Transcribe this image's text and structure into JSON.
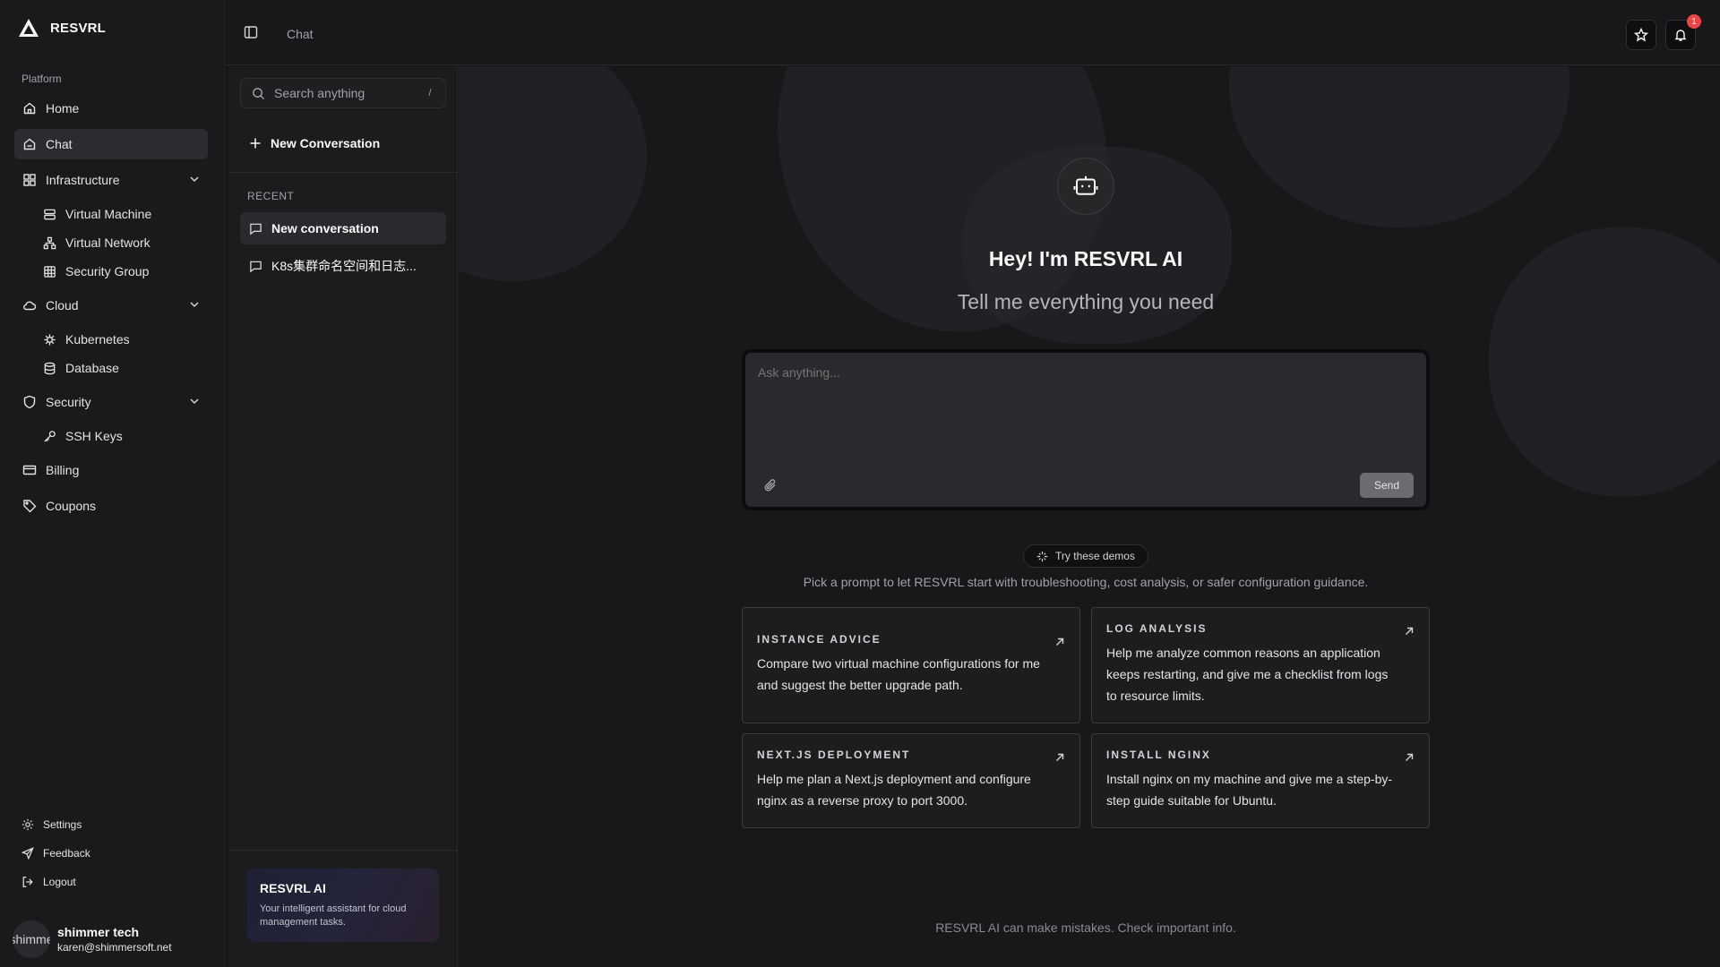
{
  "app": {
    "brand": "RESVRL"
  },
  "sidebar": {
    "group_label": "Platform",
    "items": [
      {
        "label": "Home",
        "icon": "home-icon"
      },
      {
        "label": "Chat",
        "icon": "chat-icon",
        "active": true
      },
      {
        "label": "Infrastructure",
        "icon": "grid-icon",
        "expanded": true,
        "children": [
          {
            "label": "Virtual Machine"
          },
          {
            "label": "Virtual Network"
          },
          {
            "label": "Security Group"
          }
        ]
      },
      {
        "label": "Cloud",
        "icon": "cloud-icon",
        "expanded": true,
        "children": [
          {
            "label": "Kubernetes"
          },
          {
            "label": "Database"
          }
        ]
      },
      {
        "label": "Security",
        "icon": "shield-icon",
        "expanded": true,
        "children": [
          {
            "label": "SSH Keys"
          }
        ]
      },
      {
        "label": "Billing",
        "icon": "card-icon"
      },
      {
        "label": "Coupons",
        "icon": "tag-icon"
      }
    ],
    "footer": [
      {
        "label": "Settings"
      },
      {
        "label": "Feedback"
      },
      {
        "label": "Logout"
      }
    ],
    "user": {
      "avatar_text": "shimme",
      "name": "shimmer tech",
      "email": "karen@shimmersoft.net"
    }
  },
  "topbar": {
    "breadcrumb": "Chat",
    "notification_count": "1"
  },
  "panel": {
    "search_placeholder": "Search anything",
    "search_shortcut": "/",
    "new_conversation": "New Conversation",
    "recent_label": "RECENT",
    "conversations": [
      {
        "title": "New conversation",
        "active": true
      },
      {
        "title": "K8s集群命名空间和日志..."
      }
    ],
    "ai_card": {
      "title": "RESVRL AI",
      "description": "Your intelligent assistant for cloud management tasks."
    }
  },
  "main": {
    "greeting": "Hey! I'm RESVRL AI",
    "tagline": "Tell me everything you need",
    "composer_placeholder": "Ask anything...",
    "send_label": "Send",
    "demo_pill": "Try these demos",
    "pick_text": "Pick a prompt to let RESVRL start with troubleshooting, cost analysis, or safer configuration guidance.",
    "cards": [
      {
        "title": "INSTANCE ADVICE",
        "body": "Compare two virtual machine configurations for me and suggest the better upgrade path."
      },
      {
        "title": "LOG ANALYSIS",
        "body": "Help me analyze common reasons an application keeps restarting, and give me a checklist from logs to resource limits."
      },
      {
        "title": "NEXT.JS DEPLOYMENT",
        "body": "Help me plan a Next.js deployment and configure nginx as a reverse proxy to port 3000."
      },
      {
        "title": "INSTALL NGINX",
        "body": "Install nginx on my machine and give me a step-by-step guide suitable for Ubuntu."
      }
    ],
    "disclaimer": "RESVRL AI can make mistakes. Check important info."
  },
  "colors": {
    "background": "#18181b",
    "sidebar": "#1a1a1d",
    "active_item": "#2c2c30",
    "badge": "#ef4444"
  }
}
